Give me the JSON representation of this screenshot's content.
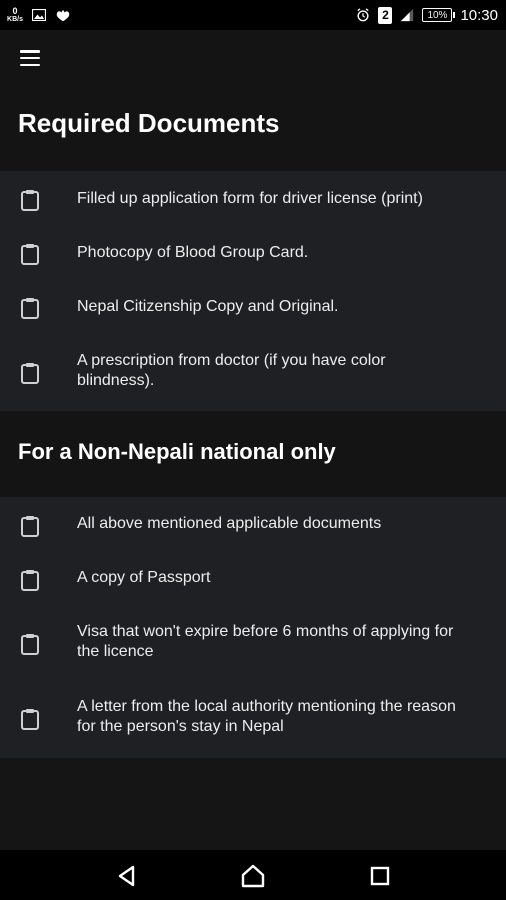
{
  "status_bar": {
    "kb_speed_top": "0",
    "kb_speed_unit": "KB/s",
    "sim_badge": "2",
    "battery": "10%",
    "time": "10:30",
    "icons": [
      "data-speed-icon",
      "image-icon",
      "notification-icon",
      "alarm-icon",
      "sim-icon",
      "signal-icon",
      "battery-icon"
    ]
  },
  "header": {
    "menu_icon": "hamburger-menu-icon",
    "title": "Required Documents"
  },
  "required_documents": [
    {
      "text": "Filled up application form for driver license (print)"
    },
    {
      "text": "Photocopy of Blood Group Card."
    },
    {
      "text": "Nepal Citizenship Copy and Original."
    },
    {
      "text": "A prescription from doctor (if you have color blindness)."
    }
  ],
  "non_nepali": {
    "title": "For a Non-Nepali national only",
    "items": [
      {
        "text": "All above mentioned applicable documents"
      },
      {
        "text": "A copy of Passport"
      },
      {
        "text": "Visa that won't expire before 6 months of applying for the licence"
      },
      {
        "text": "A letter from the local authority mentioning the reason for the person's stay in Nepal"
      }
    ]
  },
  "nav_bar": {
    "icons": [
      "back-icon",
      "home-icon",
      "recents-icon"
    ]
  },
  "colors": {
    "background": "#151515",
    "list_background": "#1f2023",
    "text": "#ededed"
  }
}
